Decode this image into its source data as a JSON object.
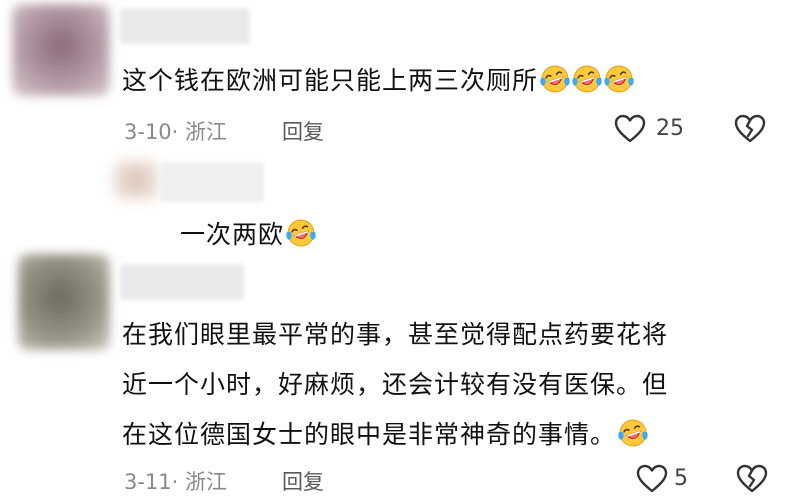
{
  "comments": [
    {
      "text": "这个钱在欧洲可能只能上两三次厕所",
      "date": "3-10",
      "location": "· 浙江",
      "reply_label": "回复",
      "likes": "25",
      "emoji_count": 3
    },
    {
      "text": "一次两欧",
      "emoji_count": 1
    },
    {
      "lines": [
        "在我们眼里最平常的事，甚至觉得配点药要花将",
        "近一个小时，好麻烦，还会计较有没有医保。但",
        "在这位德国女士的眼中是非常神奇的事情。"
      ],
      "date": "3-11",
      "location": "· 浙江",
      "reply_label": "回复",
      "likes": "5",
      "emoji_count": 1
    }
  ],
  "icons": {
    "emoji": "rolling-on-floor-laughing-emoji",
    "like": "heart-outline-icon",
    "dislike": "broken-heart-outline-icon"
  },
  "colors": {
    "emoji_face": "#FFC83D",
    "emoji_tears": "#3FA9F5",
    "meta_gray": "#8A8A8A"
  }
}
